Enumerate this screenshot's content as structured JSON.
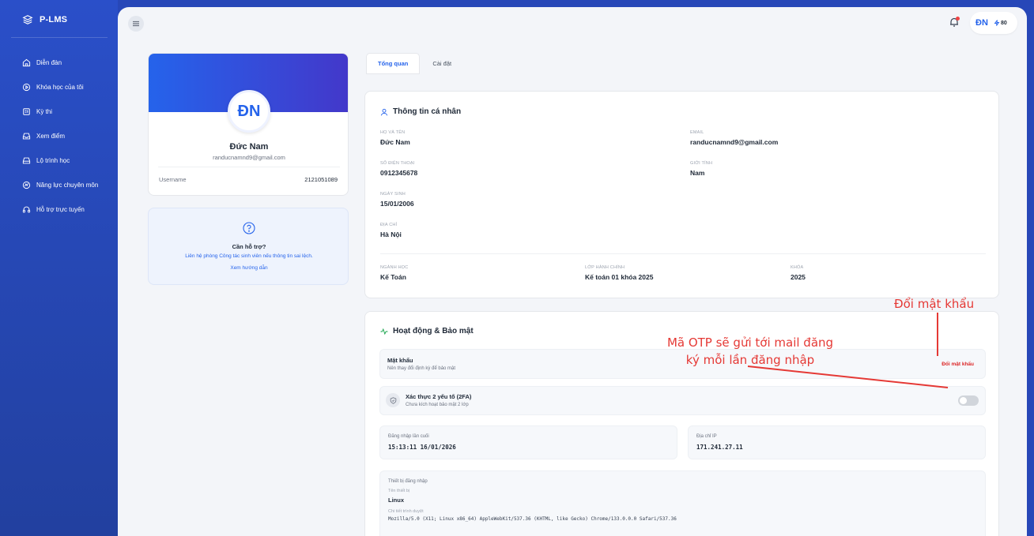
{
  "brand": {
    "name": "P-LMS"
  },
  "sidebar": {
    "items": [
      {
        "label": "Diễn đàn",
        "icon": "home-icon"
      },
      {
        "label": "Khóa học của tôi",
        "icon": "play-circle-icon"
      },
      {
        "label": "Kỳ thi",
        "icon": "exam-icon"
      },
      {
        "label": "Xem điểm",
        "icon": "inbox-icon"
      },
      {
        "label": "Lộ trình học",
        "icon": "route-icon"
      },
      {
        "label": "Năng lực chuyên môn",
        "icon": "skill-icon"
      },
      {
        "label": "Hỗ trợ trực tuyến",
        "icon": "headset-icon"
      }
    ]
  },
  "topbar": {
    "user_initials": "ĐN",
    "points": "80"
  },
  "profile": {
    "initials": "ĐN",
    "name": "Đức Nam",
    "email": "randucnamnd9@gmail.com",
    "username_label": "Username",
    "username": "2121051089"
  },
  "help": {
    "title": "Cần hỗ trợ?",
    "desc": "Liên hệ phòng Công tác sinh viên nếu thông tin sai lệch.",
    "link": "Xem hướng dẫn"
  },
  "tabs": [
    {
      "label": "Tổng quan",
      "active": true
    },
    {
      "label": "Cài đặt",
      "active": false
    }
  ],
  "personal": {
    "title": "Thông tin cá nhân",
    "fullname_label": "Họ và tên",
    "fullname": "Đức Nam",
    "email_label": "Email",
    "email": "randucnamnd9@gmail.com",
    "phone_label": "Số điện thoại",
    "phone": "0912345678",
    "gender_label": "Giới tính",
    "gender": "Nam",
    "dob_label": "Ngày sinh",
    "dob": "15/01/2006",
    "address_label": "Địa chỉ",
    "address": "Hà Nội",
    "major_label": "Ngành học",
    "major": "Kế Toán",
    "class_label": "Lớp hành chính",
    "class": "Kế toán 01 khóa 2025",
    "cohort_label": "Khóa",
    "cohort": "2025"
  },
  "security": {
    "title": "Hoạt động & Bảo mật",
    "password_title": "Mật khẩu",
    "password_sub": "Nên thay đổi định kỳ để bảo mật",
    "change_password": "Đổi mật khẩu",
    "twofa_title": "Xác thực 2 yếu tố (2FA)",
    "twofa_sub": "Chưa kích hoạt bảo mật 2 lớp",
    "twofa_enabled": false,
    "last_login_label": "Đăng nhập lần cuối",
    "last_login": "15:13:11 16/01/2026",
    "ip_label": "Địa chỉ IP",
    "ip": "171.241.27.11",
    "device_section": "Thiết bị đăng nhập",
    "device_name_label": "Tên thiết bị",
    "device_name": "Linux",
    "browser_label": "Chi tiết trình duyệt",
    "browser": "Mozilla/5.0 (X11; Linux x86_64) AppleWebKit/537.36 (KHTML, like Gecko) Chrome/133.0.0.0 Safari/537.36"
  },
  "annotations": {
    "change_password": "Đổi mật khẩu",
    "otp_line1": "Mã OTP sẽ gửi tới mail đăng",
    "otp_line2": "ký mỗi lần đăng nhập",
    "color": "#e53935"
  }
}
